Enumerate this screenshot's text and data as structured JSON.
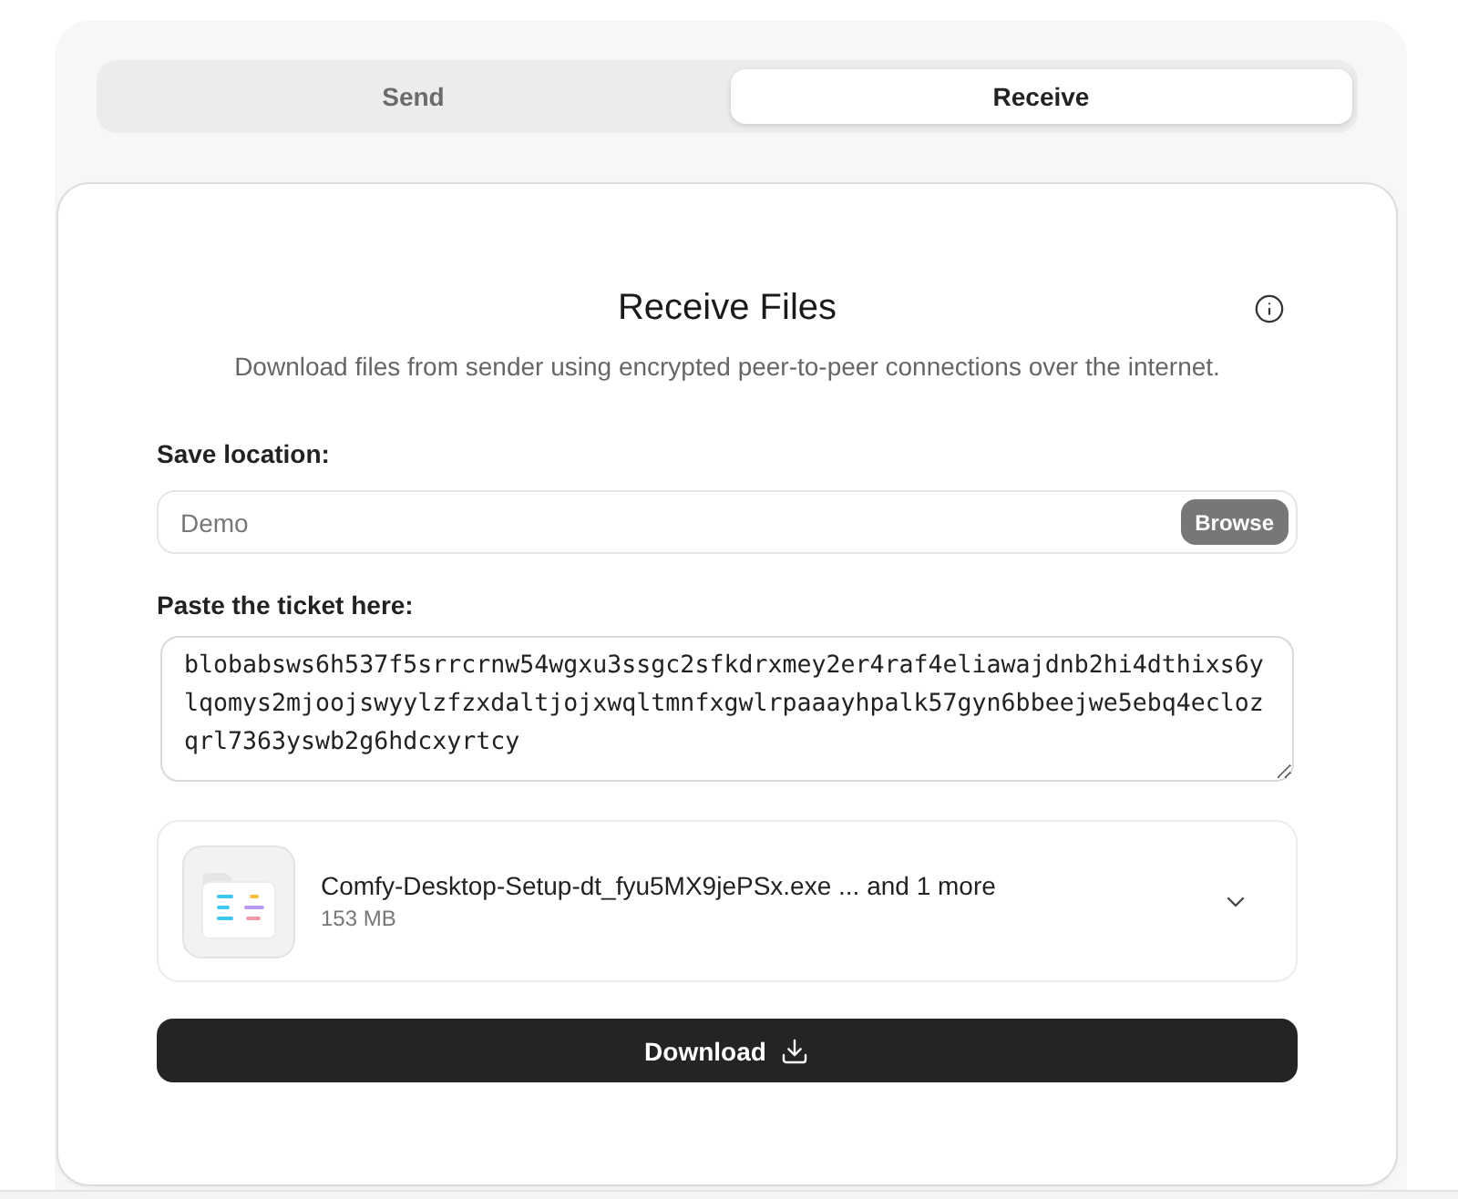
{
  "tabs": [
    {
      "label": "Send",
      "selected": false
    },
    {
      "label": "Receive",
      "selected": true
    }
  ],
  "header": {
    "title": "Receive Files",
    "subtitle": "Download files from sender using encrypted peer-to-peer connections over the internet."
  },
  "save_location": {
    "label": "Save location:",
    "value": "Demo",
    "button": "Browse"
  },
  "ticket": {
    "label": "Paste the ticket here:",
    "value": "blobabsws6h537f5srrcrnw54wgxu3ssgc2sfkdrxmey2er4raf4eliawajdnb2hi4dthixs6ylqomys2mjoojswyylzfzxdaltjojxwqltmnfxgwlrpaaayhpalk57gyn6bbeejwe5ebq4eclozqrl7363yswb2g6hdcxyrtcy"
  },
  "files": {
    "name": "Comfy-Desktop-Setup-dt_fyu5MX9jePSx.exe ... and 1 more",
    "size": "153 MB",
    "expanded": false
  },
  "download_button": {
    "label": "Download"
  }
}
